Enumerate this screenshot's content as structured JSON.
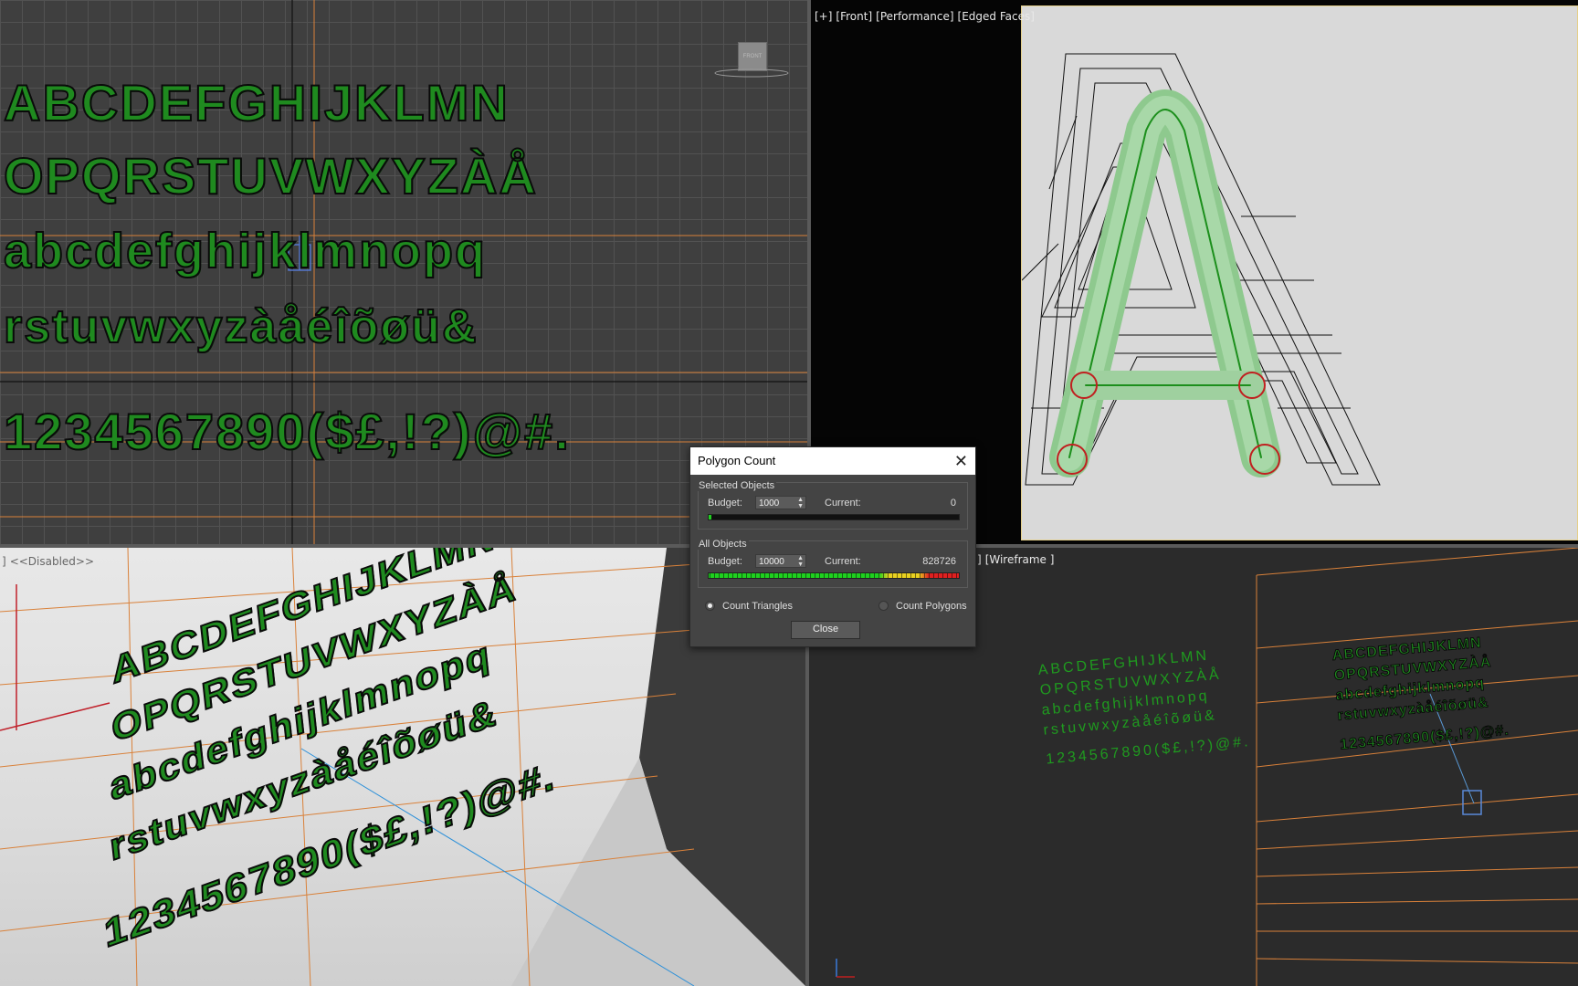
{
  "viewports": {
    "top_right_label": [
      "[+]",
      "[Front]",
      "[Performance]",
      "[Edged Faces]"
    ],
    "bottom_left_label": [
      "]",
      "<<Disabled>>"
    ],
    "bottom_right_label": [
      "]",
      "[Wireframe ]"
    ],
    "nav_cube_label": "FRONT"
  },
  "font_specimen": {
    "row1": "ABCDEFGHIJKLMN",
    "row2": "OPQRSTUVWXYZÀÅ",
    "row3": "abcdefghijklmnopq",
    "row4": "rstuvwxyzàåéîõøü&",
    "row5": "1234567890($£,!?)@#."
  },
  "dialog": {
    "title": "Polygon Count",
    "close_glyph": "✕",
    "selected": {
      "title": "Selected Objects",
      "budget_label": "Budget:",
      "budget_value": "1000",
      "current_label": "Current:",
      "current_value": "0",
      "fill_fraction": 0.01
    },
    "all": {
      "title": "All Objects",
      "budget_label": "Budget:",
      "budget_value": "10000",
      "current_label": "Current:",
      "current_value": "828726",
      "fill_fraction": 1.0
    },
    "count_triangles": "Count Triangles",
    "count_polygons": "Count Polygons",
    "close_label": "Close"
  },
  "colors": {
    "glyph_green": "#1f8a1f",
    "grid_orange": "#d9813a",
    "wire_green": "#2db52d"
  }
}
